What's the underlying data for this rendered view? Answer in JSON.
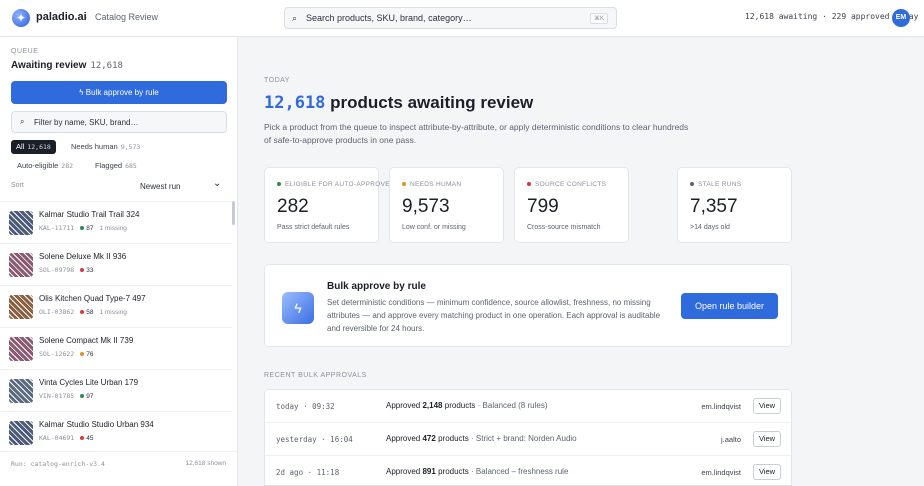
{
  "header": {
    "brand": "paladio.ai",
    "separator": "·",
    "crumb": "Catalog Review",
    "search_placeholder": "Search products, SKU, brand, category…",
    "search_shortcut": "⌘K",
    "stats": "12,618 awaiting · 229 approved today",
    "avatar_initials": "EM"
  },
  "sidebar": {
    "queue_label": "QUEUE",
    "title": "Awaiting review",
    "count": "12,618",
    "bulk_button": "Bulk approve by rule",
    "filter_placeholder": "Filter by name, SKU, brand…",
    "chips": [
      {
        "label": "All",
        "count": "12,618"
      },
      {
        "label": "Needs human",
        "count": "9,573"
      },
      {
        "label": "Auto-eligible",
        "count": "282"
      },
      {
        "label": "Flagged",
        "count": "685"
      }
    ],
    "sort_label": "Sort",
    "sort_value": "Newest run",
    "items": [
      {
        "name": "Kalmar Studio Trail Trail 324",
        "sku": "KAL-11711",
        "score": "87",
        "missing": "1 missing",
        "dot": "#2e8b57",
        "thumb": "#4a5a78"
      },
      {
        "name": "Solene Deluxe Mk II 936",
        "sku": "SOL-09798",
        "score": "33",
        "missing": "",
        "dot": "#d93b3b",
        "thumb": "#8a5a72"
      },
      {
        "name": "Olis Kitchen Quad Type-7 497",
        "sku": "OLI-03862",
        "score": "58",
        "missing": "1 missing",
        "dot": "#d93b3b",
        "thumb": "#8a6040"
      },
      {
        "name": "Solene Compact Mk II 739",
        "sku": "SOL-12622",
        "score": "76",
        "missing": "",
        "dot": "#d9922e",
        "thumb": "#8a5a72"
      },
      {
        "name": "Vinta Cycles Lite Urban 179",
        "sku": "VIN-01785",
        "score": "97",
        "missing": "",
        "dot": "#2e8b57",
        "thumb": "#5a6a80"
      },
      {
        "name": "Kalmar Studio Studio Urban 934",
        "sku": "KAL-04691",
        "score": "45",
        "missing": "",
        "dot": "#d93b3b",
        "thumb": "#4a5a78"
      }
    ],
    "footer_run": "Run: catalog-enrich-v3.4",
    "footer_shown": "12,618 shown"
  },
  "main": {
    "today_label": "TODAY",
    "headline_number": "12,618",
    "headline_text": "products awaiting review",
    "description": "Pick a product from the queue to inspect attribute-by-attribute, or apply deterministic conditions to clear hundreds of safe-to-approve products in one pass.",
    "cards": [
      {
        "label": "ELIGIBLE FOR AUTO-APPROVE",
        "value": "282",
        "sub": "Pass strict default rules",
        "color": "#2e8b57"
      },
      {
        "label": "NEEDS HUMAN",
        "value": "9,573",
        "sub": "Low conf. or missing",
        "color": "#d9922e"
      },
      {
        "label": "SOURCE CONFLICTS",
        "value": "799",
        "sub": "Cross-source mismatch",
        "color": "#d93b3b"
      },
      {
        "label": "STALE RUNS",
        "value": "7,357",
        "sub": ">14 days old",
        "color": "#5c6370"
      }
    ],
    "rule_card": {
      "title": "Bulk approve by rule",
      "description": "Set deterministic conditions — minimum confidence, source allowlist, freshness, no missing attributes — and approve every matching product in one operation. Each approval is auditable and reversible for 24 hours.",
      "button": "Open rule builder"
    },
    "recent_label": "RECENT BULK APPROVALS",
    "recent": [
      {
        "when": "today · 09:32",
        "prefix": "Approved",
        "count": "2,148",
        "suffix": "products",
        "rule": "· Balanced (8 rules)",
        "user": "em.lindqvist",
        "action": "View"
      },
      {
        "when": "yesterday · 16:04",
        "prefix": "Approved",
        "count": "472",
        "suffix": "products",
        "rule": "· Strict + brand: Norden Audio",
        "user": "j.aalto",
        "action": "View"
      },
      {
        "when": "2d ago · 11:18",
        "prefix": "Approved",
        "count": "891",
        "suffix": "products",
        "rule": "· Balanced – freshness rule",
        "user": "em.lindqvist",
        "action": "View"
      }
    ]
  }
}
